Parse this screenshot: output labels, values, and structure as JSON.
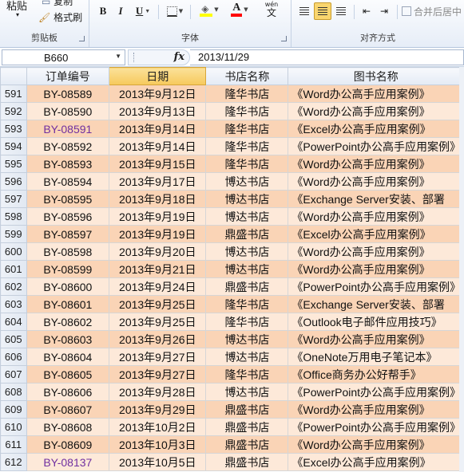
{
  "ribbon": {
    "clipboard": {
      "paste_label": "粘贴",
      "copy_label": "复制",
      "format_painter_label": "格式刷",
      "group_label": "剪贴板"
    },
    "font": {
      "bold": "B",
      "italic": "I",
      "underline": "U",
      "font_color_letter": "A",
      "wen_label": "wén",
      "wen_char": "文",
      "group_label": "字体"
    },
    "alignment": {
      "merge_label": "合并后居中",
      "group_label": "对齐方式"
    },
    "colors": {
      "highlight_yellow": "#ffff00",
      "font_red": "#ff0000",
      "active_align": "#f9d56e"
    }
  },
  "formula_bar": {
    "name_box": "B660",
    "fx_label": "fx",
    "formula_value": "2013/11/29"
  },
  "columns": [
    "订单编号",
    "日期",
    "书店名称",
    "图书名称"
  ],
  "selected_column": 1,
  "rows": [
    {
      "num": "591",
      "id": "BY-08589",
      "date": "2013年9月12日",
      "store": "隆华书店",
      "book": "《Word办公高手应用案例》",
      "purple": false
    },
    {
      "num": "592",
      "id": "BY-08590",
      "date": "2013年9月13日",
      "store": "隆华书店",
      "book": "《Word办公高手应用案例》",
      "purple": false
    },
    {
      "num": "593",
      "id": "BY-08591",
      "date": "2013年9月14日",
      "store": "隆华书店",
      "book": "《Excel办公高手应用案例》",
      "purple": true
    },
    {
      "num": "594",
      "id": "BY-08592",
      "date": "2013年9月14日",
      "store": "隆华书店",
      "book": "《PowerPoint办公高手应用案例》",
      "purple": false
    },
    {
      "num": "595",
      "id": "BY-08593",
      "date": "2013年9月15日",
      "store": "隆华书店",
      "book": "《Word办公高手应用案例》",
      "purple": false
    },
    {
      "num": "596",
      "id": "BY-08594",
      "date": "2013年9月17日",
      "store": "博达书店",
      "book": "《Word办公高手应用案例》",
      "purple": false
    },
    {
      "num": "597",
      "id": "BY-08595",
      "date": "2013年9月18日",
      "store": "博达书店",
      "book": "《Exchange Server安装、部署",
      "purple": false
    },
    {
      "num": "598",
      "id": "BY-08596",
      "date": "2013年9月19日",
      "store": "博达书店",
      "book": "《Word办公高手应用案例》",
      "purple": false
    },
    {
      "num": "599",
      "id": "BY-08597",
      "date": "2013年9月19日",
      "store": "鼎盛书店",
      "book": "《Excel办公高手应用案例》",
      "purple": false
    },
    {
      "num": "600",
      "id": "BY-08598",
      "date": "2013年9月20日",
      "store": "博达书店",
      "book": "《Word办公高手应用案例》",
      "purple": false
    },
    {
      "num": "601",
      "id": "BY-08599",
      "date": "2013年9月21日",
      "store": "博达书店",
      "book": "《Word办公高手应用案例》",
      "purple": false
    },
    {
      "num": "602",
      "id": "BY-08600",
      "date": "2013年9月24日",
      "store": "鼎盛书店",
      "book": "《PowerPoint办公高手应用案例》",
      "purple": false
    },
    {
      "num": "603",
      "id": "BY-08601",
      "date": "2013年9月25日",
      "store": "隆华书店",
      "book": "《Exchange Server安装、部署",
      "purple": false
    },
    {
      "num": "604",
      "id": "BY-08602",
      "date": "2013年9月25日",
      "store": "隆华书店",
      "book": "《Outlook电子邮件应用技巧》",
      "purple": false
    },
    {
      "num": "605",
      "id": "BY-08603",
      "date": "2013年9月26日",
      "store": "博达书店",
      "book": "《Word办公高手应用案例》",
      "purple": false
    },
    {
      "num": "606",
      "id": "BY-08604",
      "date": "2013年9月27日",
      "store": "博达书店",
      "book": "《OneNote万用电子笔记本》",
      "purple": false
    },
    {
      "num": "607",
      "id": "BY-08605",
      "date": "2013年9月27日",
      "store": "隆华书店",
      "book": "《Office商务办公好帮手》",
      "purple": false
    },
    {
      "num": "608",
      "id": "BY-08606",
      "date": "2013年9月28日",
      "store": "博达书店",
      "book": "《PowerPoint办公高手应用案例》",
      "purple": false
    },
    {
      "num": "609",
      "id": "BY-08607",
      "date": "2013年9月29日",
      "store": "鼎盛书店",
      "book": "《Word办公高手应用案例》",
      "purple": false
    },
    {
      "num": "610",
      "id": "BY-08608",
      "date": "2013年10月2日",
      "store": "鼎盛书店",
      "book": "《PowerPoint办公高手应用案例》",
      "purple": false
    },
    {
      "num": "611",
      "id": "BY-08609",
      "date": "2013年10月3日",
      "store": "鼎盛书店",
      "book": "《Word办公高手应用案例》",
      "purple": false
    },
    {
      "num": "612",
      "id": "BY-08137",
      "date": "2013年10月5日",
      "store": "鼎盛书店",
      "book": "《Excel办公高手应用案例》",
      "purple": true
    }
  ]
}
